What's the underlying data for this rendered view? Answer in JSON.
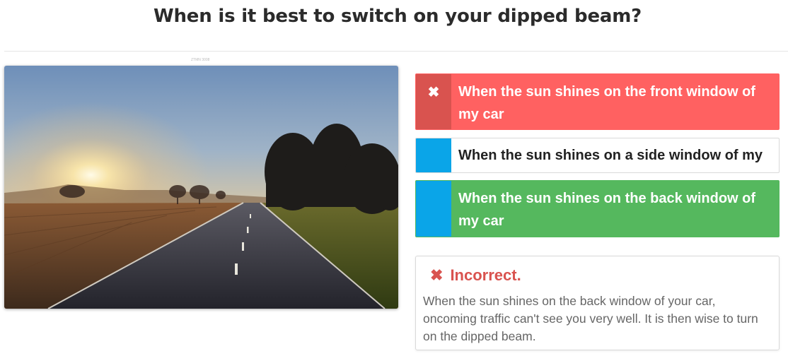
{
  "question": "When is it best to switch on your dipped beam?",
  "image_caption": "ZTMN 3008",
  "answers": [
    {
      "label": "When the sun shines on the front window of my car",
      "state": "wrong-selected",
      "icon": "✖"
    },
    {
      "label": "When the sun shines on a side window of my car",
      "state": "neutral",
      "icon": ""
    },
    {
      "label": "When the sun shines on the back window of my car",
      "state": "correct",
      "icon": ""
    }
  ],
  "feedback": {
    "icon": "✖",
    "title": "Incorrect.",
    "text": "When the sun shines on the back window of your car, oncoming traffic can't see you very well. It is then wise to turn on the dipped beam."
  },
  "colors": {
    "wrong": "#ff6161",
    "wrong_dark": "#d9534f",
    "correct": "#55b85e",
    "neutral_marker": "#0aa5e8"
  }
}
